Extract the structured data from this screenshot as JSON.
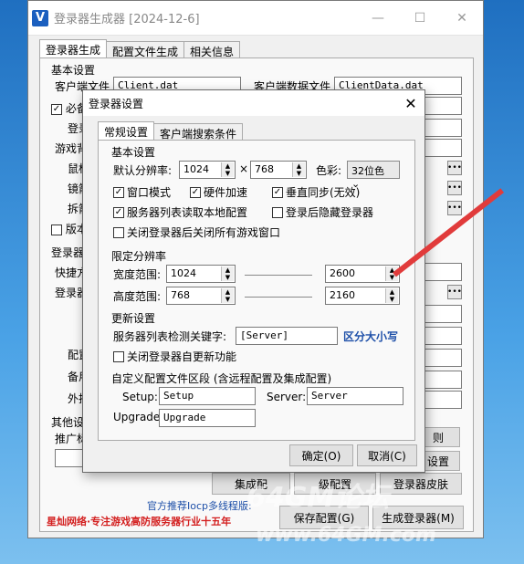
{
  "window": {
    "title": "登录器生成器 [2024-12-6]",
    "tabs": [
      "登录器生成",
      "配置文件生成",
      "相关信息"
    ]
  },
  "main": {
    "basic_group": "基本设置",
    "client_file_label": "客户端文件",
    "client_file_value": "Client.dat",
    "client_data_label": "客户端数据文件",
    "client_data_value": "ClientData.dat",
    "required_label": "必备",
    "login_label": "登录",
    "game_label": "游戏背",
    "mouse_label": "鼠标",
    "mirror_label": "镜箭",
    "split_label": "拆箭",
    "version_label": "版本",
    "login2_group": "登录器",
    "shortcut_label": "快捷方",
    "login3_label": "登录器",
    "backup_label": "备",
    "config_label": "配置",
    "backup2_label": "备用",
    "plugin_label": "外挂",
    "other_group": "其他设",
    "promo_label": "推广标",
    "rule_label": "则",
    "setting_label": "设置",
    "gen_config_label": "集成配",
    "gen_launcher_label": "级配置",
    "gen_skin_label": "登录器皮肤",
    "recommend": "官方推荐Iocp多线程版:",
    "brand": "星灿网络·专注游戏高防服务器行业十五年",
    "save_btn": "保存配置(G)",
    "generate_btn": "生成登录器(M)"
  },
  "dialog": {
    "title": "登录器设置",
    "tabs": [
      "常规设置",
      "客户端搜索条件"
    ],
    "basic_group": "基本设置",
    "res_label": "默认分辨率:",
    "res_w": "1024",
    "res_x": "×",
    "res_h": "768",
    "color_label": "色彩:",
    "color_value": "32位色",
    "options": [
      {
        "label": "窗口模式",
        "checked": true
      },
      {
        "label": "硬件加速",
        "checked": true
      },
      {
        "label": "垂直同步(无效)",
        "checked": true
      },
      {
        "label": "服务器列表读取本地配置",
        "checked": true
      },
      {
        "label": "登录后隐藏登录器",
        "checked": false
      },
      {
        "label": "关闭登录器后关闭所有游戏窗口",
        "checked": false
      }
    ],
    "limit_group": "限定分辨率",
    "width_label": "宽度范围:",
    "width_min": "1024",
    "width_max": "2600",
    "height_label": "高度范围:",
    "height_min": "768",
    "height_max": "2160",
    "update_group": "更新设置",
    "keyword_label": "服务器列表检测关键字:",
    "keyword_value": "[Server]",
    "case_note": "区分大小写",
    "disable_update_label": "关闭登录器自更新功能",
    "custom_group": "自定义配置文件区段 (含远程配置及集成配置)",
    "setup_label": "Setup:",
    "setup_value": "Setup",
    "server_label": "Server:",
    "server_value": "Server",
    "upgrade_label": "Upgrade:",
    "upgrade_value": "Upgrade",
    "ok_btn": "确定(O)",
    "cancel_btn": "取消(C)"
  },
  "watermark": {
    "line1": "64GM论坛",
    "line2": "www.64GM.com"
  },
  "colors": {
    "accent": "#1d4fa8",
    "brand_red": "#d31f1f",
    "arrow": "#e13b3b"
  }
}
